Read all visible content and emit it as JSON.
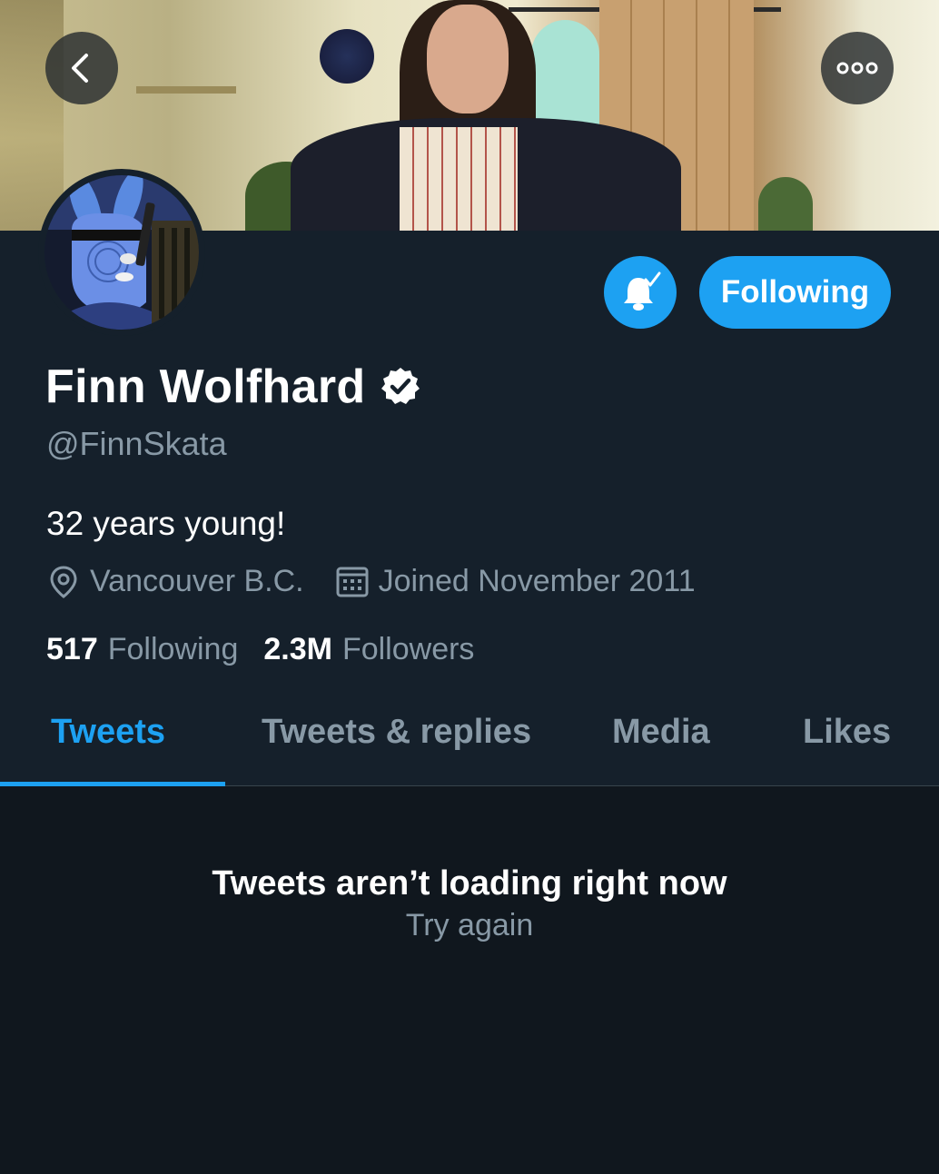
{
  "profile": {
    "display_name": "Finn Wolfhard",
    "handle": "@FinnSkata",
    "bio": "32 years young!",
    "location": "Vancouver B.C.",
    "joined": "Joined November 2011",
    "verified": true
  },
  "stats": {
    "following_count": "517",
    "following_label": "Following",
    "followers_count": "2.3M",
    "followers_label": "Followers"
  },
  "actions": {
    "following_button": "Following",
    "notifications_icon": "bell-check-icon",
    "back_icon": "chevron-left-icon",
    "more_icon": "more-icon"
  },
  "tabs": [
    {
      "label": "Tweets",
      "active": true
    },
    {
      "label": "Tweets & replies",
      "active": false
    },
    {
      "label": "Media",
      "active": false
    },
    {
      "label": "Likes",
      "active": false
    }
  ],
  "feed": {
    "error_message": "Tweets aren’t loading right now",
    "retry_label": "Try again"
  },
  "colors": {
    "background": "#15202b",
    "feed_background": "#10171e",
    "accent": "#1da1f2",
    "secondary_text": "#8899a6",
    "divider": "#38444d"
  }
}
